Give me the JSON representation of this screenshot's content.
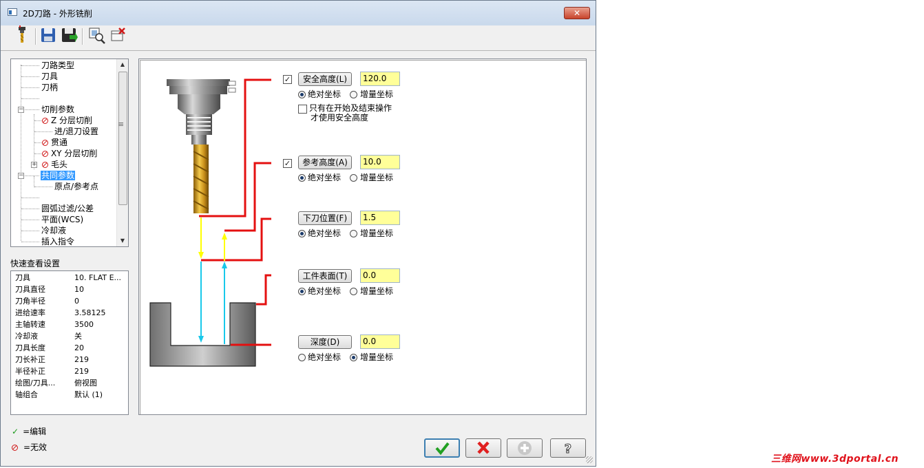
{
  "window": {
    "title": "2D刀路 - 外形铣削",
    "close_label": "✕"
  },
  "toolbar": {
    "buttons": [
      {
        "name": "tool-icon"
      },
      {
        "name": "save-icon"
      },
      {
        "name": "save-as-icon"
      },
      {
        "name": "view-icon"
      },
      {
        "name": "delete-icon"
      }
    ]
  },
  "tree": {
    "items": [
      {
        "label": "刀路类型"
      },
      {
        "label": "刀具"
      },
      {
        "label": "刀柄"
      },
      {
        "label": ""
      },
      {
        "label": "切削参数"
      },
      {
        "label": "Z 分层切削",
        "status": "invalid"
      },
      {
        "label": "进/退刀设置"
      },
      {
        "label": "贯通",
        "status": "invalid"
      },
      {
        "label": "XY 分层切削",
        "status": "invalid"
      },
      {
        "label": "毛头",
        "status": "invalid"
      },
      {
        "label": "共同参数",
        "selected": true
      },
      {
        "label": "原点/参考点"
      },
      {
        "label": ""
      },
      {
        "label": "圆弧过滤/公差"
      },
      {
        "label": "平面(WCS)"
      },
      {
        "label": "冷却液"
      },
      {
        "label": "插入指令"
      }
    ]
  },
  "quickview": {
    "title": "快速查看设置",
    "rows": [
      {
        "k": "刀具",
        "v": "10. FLAT E..."
      },
      {
        "k": "刀具直径",
        "v": "10"
      },
      {
        "k": "刀角半径",
        "v": "0"
      },
      {
        "k": "进给速率",
        "v": "3.58125"
      },
      {
        "k": "主轴转速",
        "v": "3500"
      },
      {
        "k": "冷却液",
        "v": "关"
      },
      {
        "k": "刀具长度",
        "v": "20"
      },
      {
        "k": "刀长补正",
        "v": "219"
      },
      {
        "k": "半径补正",
        "v": "219"
      },
      {
        "k": "绘图/刀具...",
        "v": "俯视图"
      },
      {
        "k": "轴组合",
        "v": "默认 (1)"
      }
    ]
  },
  "legend": {
    "edit_label": "=编辑",
    "invalid_label": "=无效"
  },
  "params": {
    "clearance": {
      "label": "安全高度(L)",
      "value": "120.0",
      "checked": true,
      "abs": "绝对坐标",
      "inc": "增量坐标",
      "mode": "abs",
      "only_start_end_line1": "只有在开始及结束操作",
      "only_start_end_line2": "才使用安全高度"
    },
    "retract": {
      "label": "参考高度(A)",
      "value": "10.0",
      "checked": true,
      "abs": "绝对坐标",
      "inc": "增量坐标",
      "mode": "abs"
    },
    "feed_plane": {
      "label": "下刀位置(F)",
      "value": "1.5",
      "abs": "绝对坐标",
      "inc": "增量坐标",
      "mode": "abs"
    },
    "top_stock": {
      "label": "工件表面(T)",
      "value": "0.0",
      "abs": "绝对坐标",
      "inc": "增量坐标",
      "mode": "abs"
    },
    "depth": {
      "label": "深度(D)",
      "value": "0.0",
      "abs": "绝对坐标",
      "inc": "增量坐标",
      "mode": "inc"
    }
  },
  "colors": {
    "red_line": "#e41010",
    "yellow_arrow": "#ffff00",
    "cyan_arrow": "#18c8ea",
    "field_bg": "#ffff99"
  },
  "dialog_buttons": [
    {
      "name": "ok-button",
      "icon": "check-icon"
    },
    {
      "name": "cancel-button",
      "icon": "x-icon"
    },
    {
      "name": "add-button",
      "icon": "plus-icon"
    },
    {
      "name": "help-button",
      "icon": "question-icon"
    }
  ],
  "watermark": "三维网www.3dportal.cn"
}
